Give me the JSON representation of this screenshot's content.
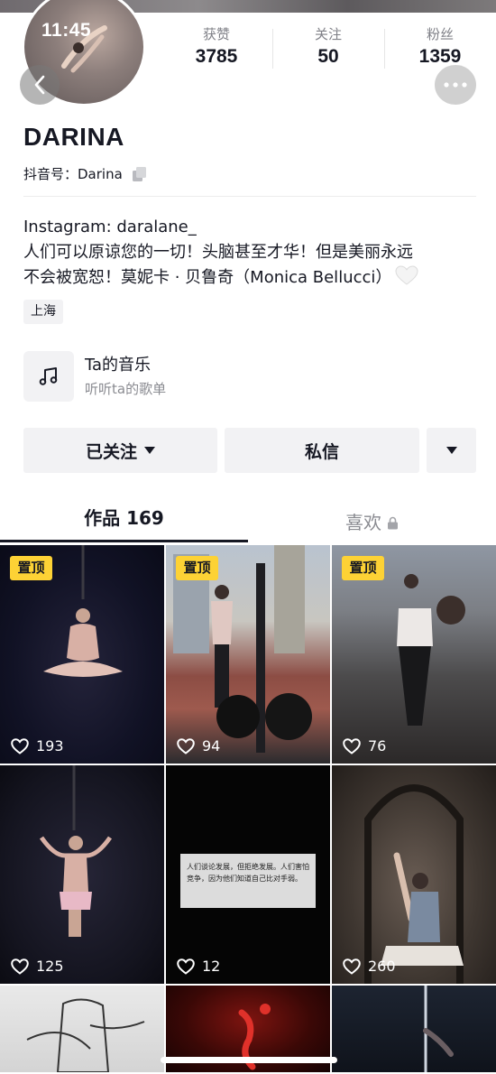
{
  "status_bar": {
    "time": "11:45"
  },
  "profile": {
    "name": "DARINA",
    "douyin_id": "抖音号：Darina",
    "stats": [
      {
        "label": "获赞",
        "value": "3785"
      },
      {
        "label": "关注",
        "value": "50"
      },
      {
        "label": "粉丝",
        "value": "1359"
      }
    ],
    "bio_line1": "Instagram: daralane_",
    "bio_line2": "人们可以原谅您的一切！头脑甚至才华！但是美丽永远",
    "bio_line3": "不会被宽恕！莫妮卡 · 贝鲁奇（Monica Bellucci）",
    "location": "上海"
  },
  "music": {
    "title": "Ta的音乐",
    "subtitle": "听听ta的歌单"
  },
  "actions": {
    "follow_label": "已关注",
    "message_label": "私信"
  },
  "tabs": {
    "works_label": "作品 169",
    "likes_label": "喜欢"
  },
  "grid": {
    "pin_label": "置顶",
    "items": [
      {
        "likes": "193"
      },
      {
        "likes": "94"
      },
      {
        "likes": "76"
      },
      {
        "likes": "125"
      },
      {
        "likes": "12",
        "quote": "人们谈论发展，但拒绝发展。人们害怕竞争，因为他们知道自己比对手弱。"
      },
      {
        "likes": "260"
      }
    ]
  },
  "colors": {
    "pin_bg": "#fdd235",
    "text": "#161823",
    "muted": "#8a8b91",
    "button_bg": "#f2f2f4"
  }
}
